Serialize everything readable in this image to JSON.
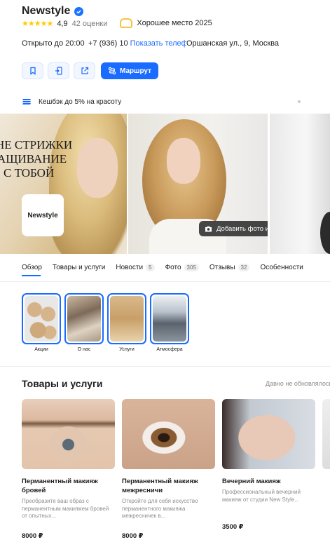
{
  "header": {
    "title": "Newstyle",
    "stars": "★★★★★",
    "rating": "4,9",
    "reviews": "42 оценки",
    "award": "Хорошее место 2025"
  },
  "info": {
    "open": "Открыто до 20:00",
    "phone": "+7 (936) 10",
    "show_phone": "Показать телефон",
    "address": "Оршанская ул., 9, Москва"
  },
  "actions": {
    "route": "Маршрут"
  },
  "cashback": "Кешбэк до 5% на красоту",
  "gallery": {
    "promo_lines": [
      "НЕ СТРИЖКИ",
      "АЩИВАНИЕ",
      "С ТОБОЙ"
    ],
    "logo": "Newstyle",
    "add_photo": "Добавить фото или видео"
  },
  "tabs": [
    {
      "label": "Обзор",
      "count": ""
    },
    {
      "label": "Товары и услуги",
      "count": ""
    },
    {
      "label": "Новости",
      "count": "5"
    },
    {
      "label": "Фото",
      "count": "305"
    },
    {
      "label": "Отзывы",
      "count": "32"
    },
    {
      "label": "Особенности",
      "count": ""
    }
  ],
  "stories": [
    {
      "label": "Акции"
    },
    {
      "label": "О нас"
    },
    {
      "label": "Услуги"
    },
    {
      "label": "Атмосфера"
    }
  ],
  "products_section": {
    "title": "Товары и услуги",
    "note": "Давно не обновлялось"
  },
  "products": [
    {
      "name": "Перманентный макияж бровей",
      "desc": "Преобразите ваш образ с перманентным макияжем бровей от опытных...",
      "price": "8000 ₽"
    },
    {
      "name": "Перманентный макияж межресничи",
      "desc": "Откройте для себя искусство перманентного макияжа межресничек в...",
      "price": "8000 ₽"
    },
    {
      "name": "Вечерний макияж",
      "desc": "Профессиональный вечерний макияж от студии New Style...",
      "price": "3500 ₽"
    }
  ],
  "colors": {
    "accent": "#1a6bff",
    "star": "#ffcc00"
  }
}
